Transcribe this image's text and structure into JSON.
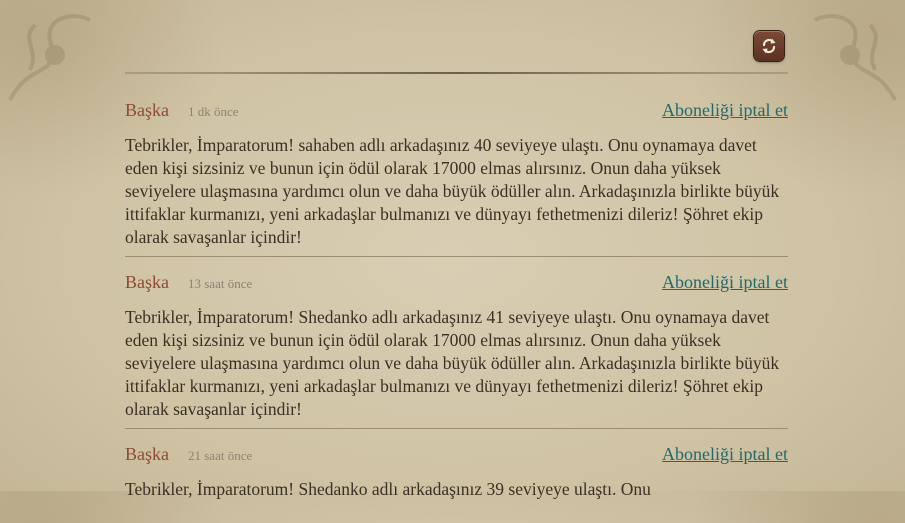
{
  "toolbar": {
    "refresh_icon": "refresh-icon"
  },
  "notifications": [
    {
      "sender": "Başka",
      "time": "1 dk önce",
      "action": "Aboneliği iptal et",
      "message": "Tebrikler, İmparatorum! sahaben adlı arkadaşınız 40 seviyeye ulaştı. Onu oynamaya davet eden kişi sizsiniz ve bunun için ödül olarak 17000 elmas alırsınız. Onun daha yüksek seviyelere ulaşmasına yardımcı olun ve daha büyük ödüller alın. Arkadaşınızla birlikte büyük ittifaklar kurmanızı, yeni arkadaşlar bulmanızı ve dünyayı fethetmenizi dileriz! Şöhret ekip olarak savaşanlar içindir!"
    },
    {
      "sender": "Başka",
      "time": "13 saat önce",
      "action": "Aboneliği iptal et",
      "message": "Tebrikler, İmparatorum! Shedanko adlı arkadaşınız 41 seviyeye ulaştı. Onu oynamaya davet eden kişi sizsiniz ve bunun için ödül olarak 17000 elmas alırsınız. Onun daha yüksek seviyelere ulaşmasına yardımcı olun ve daha büyük ödüller alın. Arkadaşınızla birlikte büyük ittifaklar kurmanızı, yeni arkadaşlar bulmanızı ve dünyayı fethetmenizi dileriz! Şöhret ekip olarak savaşanlar içindir!"
    },
    {
      "sender": "Başka",
      "time": "21 saat önce",
      "action": "Aboneliği iptal et",
      "message": "Tebrikler, İmparatorum! Shedanko adlı arkadaşınız 39 seviyeye ulaştı. Onu"
    }
  ]
}
